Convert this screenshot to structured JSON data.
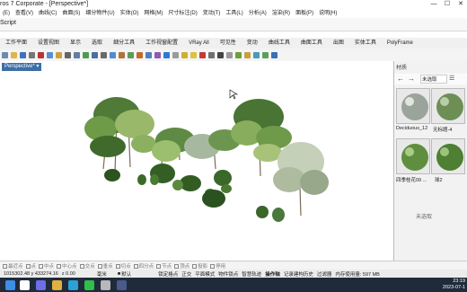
{
  "window": {
    "title": "ros 7 Corporate - [Perspective*]",
    "minimize": "—",
    "maximize": "☐",
    "close": "✕"
  },
  "menu": [
    "(E)",
    "查看(V)",
    "曲线(C)",
    "曲面(S)",
    "细分物件(U)",
    "实体(O)",
    "网格(M)",
    "尺寸标注(D)",
    "变动(T)",
    "工具(L)",
    "分析(A)",
    "渲染(R)",
    "面板(P)",
    "说明(H)"
  ],
  "command": {
    "label": "Script"
  },
  "tabs": [
    "工作平面",
    "设置视图",
    "显示",
    "选取",
    "细分工具",
    "工作视窗配置",
    "VRay All",
    "可见性",
    "变动",
    "曲线工具",
    "曲面工具",
    "出图",
    "实体工具",
    "PolyFrame"
  ],
  "toolbar_icons": [
    "new-icon",
    "open-icon",
    "save-icon",
    "print-icon",
    "cut-icon",
    "copy-icon",
    "paste-icon",
    "undo-icon",
    "pan-icon",
    "rotate-view-icon",
    "zoom-icon",
    "zoom-window-icon",
    "zoom-extents-icon",
    "zoom-selected-icon",
    "cplane-icon",
    "grid-icon",
    "points-icon",
    "curve-icon",
    "shade-icon",
    "wireframe-icon",
    "render-icon",
    "light-icon",
    "material-icon",
    "sphere-icon",
    "sphere2-icon",
    "sphere3-icon",
    "options-icon",
    "layer-icon",
    "texture-icon",
    "settings-icon",
    "help-icon"
  ],
  "toolbar_colors": [
    "#6b8bb3",
    "#e2b34a",
    "#3f73b8",
    "#777777",
    "#bb3333",
    "#5a8fd1",
    "#cfa040",
    "#666666",
    "#5f7fa6",
    "#4e9b4e",
    "#4a6fa0",
    "#6a6a6a",
    "#4d8ecf",
    "#b0733a",
    "#5b9c5b",
    "#c46a2a",
    "#4f80bf",
    "#8e5ab3",
    "#2c7bd0",
    "#9a9a9a",
    "#d0b030",
    "#e0c040",
    "#c23a3a",
    "#707070",
    "#444444",
    "#9a9a9a",
    "#6f9f3a",
    "#c8a040",
    "#4a9ab8",
    "#5ba05b",
    "#3a70b5"
  ],
  "viewport": {
    "label": "Perspective*"
  },
  "panel": {
    "title": "材质",
    "select_label": "未选取",
    "materials": [
      {
        "name": "Deciduous_12"
      },
      {
        "name": "无标题-4"
      },
      {
        "name": "四季桂花09 ..."
      },
      {
        "name": "球2"
      }
    ],
    "empty_text": "未选取"
  },
  "osnap": [
    "最近点",
    "点",
    "中点",
    "中心点",
    "交点",
    "垂点",
    "切点",
    "四分点",
    "节点",
    "顶点",
    "投影",
    "停用"
  ],
  "status": {
    "coords": "1015302.48 y 433274.16",
    "z": "z 0.00",
    "units": "毫米",
    "layer": "默认",
    "items": [
      "锁定格点",
      "正交",
      "平面模式",
      "物件锁点",
      "智慧轨迹",
      "操作轴",
      "记录建构历史",
      "过滤器",
      "内存使用量: 597 MB"
    ]
  },
  "taskbar": {
    "time": "23:19",
    "date": "2023-07-1",
    "apps": [
      "windows-icon",
      "search-icon",
      "chat-icon",
      "explorer-icon",
      "edge-icon",
      "wechat-icon",
      "rhino-icon",
      "vray-icon"
    ],
    "app_colors": [
      "#3c8ee6",
      "#ffffff",
      "#6d6ee8",
      "#e0b040",
      "#2aa2d8",
      "#2fbf4a",
      "#b8b8b8",
      "#4a5a8a"
    ]
  },
  "colors": {
    "accent": "#3d6ea5",
    "foliage_dark": "#2f5a22",
    "foliage_light": "#8fb85e",
    "trunk": "#7a6a58"
  }
}
